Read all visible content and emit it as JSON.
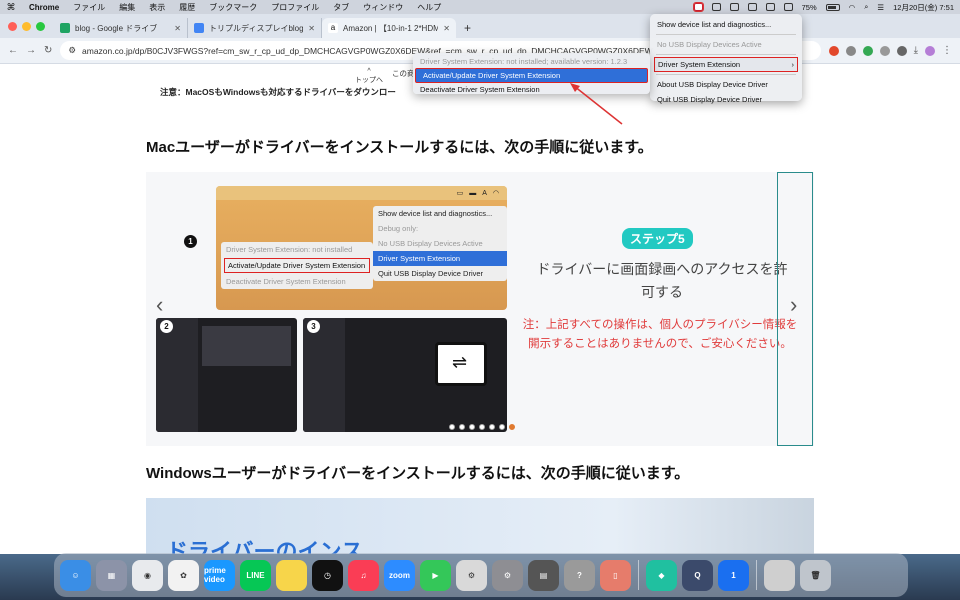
{
  "menubar": {
    "app": "Chrome",
    "items": [
      "ファイル",
      "編集",
      "表示",
      "履歴",
      "ブックマーク",
      "プロファイル",
      "タブ",
      "ウィンドウ",
      "ヘルプ"
    ],
    "battery": "75%",
    "datetime": "12月20日(金)  7:51"
  },
  "tabs": [
    {
      "title": "blog - Google ドライブ",
      "color": "#1fa463"
    },
    {
      "title": "トリプルディスプレイblog 最佳",
      "color": "#4285f4"
    },
    {
      "title": "Amazon | 【10-in-1 2*HDMI A",
      "color": "#222222"
    }
  ],
  "omnibox": {
    "url": "amazon.co.jp/dp/B0CJV3FWGS?ref=cm_sw_r_cp_ud_dp_DMCHCAGVGP0WGZ0X6DEW&ref_=cm_sw_r_cp_ud_dp_DMCHCAGVGP0WGZ0X6DEW"
  },
  "page": {
    "top_link": "トップへ",
    "cut_text": "この商",
    "note": "注意：MacOSもWindowsも対応するドライバーをダウンロー",
    "heading_mac": "Macユーザーがドライバーをインストールするには、次の手順に従います。",
    "heading_win": "Windowsユーザーがドライバーをインストールするには、次の手順に従います。",
    "bottom_big": "ドライバーのインス"
  },
  "slide": {
    "mock_menu": [
      "Show device list and diagnostics...",
      "Debug only:",
      "No USB Display Devices Active",
      "Driver System Extension",
      "Quit USB Display Device Driver"
    ],
    "mock_sub": [
      "Driver System Extension: not installed",
      "Activate/Update Driver System Extension",
      "Deactivate Driver System Extension"
    ],
    "numbers": [
      "1",
      "2",
      "3"
    ],
    "step_pill": "ステップ5",
    "step_title": "ドライバーに画面録画へのアクセスを許可する",
    "step_note": "注：上記すべての操作は、個人のプライバシー情報を開示することはありませんので、ご安心ください。",
    "prev": "‹",
    "next": "›",
    "active_dot": 6
  },
  "sysmenu": {
    "items": [
      "Show device list and diagnostics...",
      "No USB Display Devices Active",
      "Driver System Extension",
      "About USB Display Device Driver",
      "Quit USB Display Device Driver"
    ]
  },
  "submenu": {
    "items": [
      "Driver System Extension: not installed; available version: 1.2.3",
      "Activate/Update Driver System Extension",
      "Deactivate Driver System Extension"
    ]
  },
  "dock": {
    "apps": [
      {
        "name": "finder",
        "label": "☺",
        "color": "#3a8ee6"
      },
      {
        "name": "launchpad",
        "label": "▦",
        "color": "#8c93a8"
      },
      {
        "name": "chrome",
        "label": "◉",
        "color": "#e8eaed"
      },
      {
        "name": "photos",
        "label": "✿",
        "color": "#f2f2f2"
      },
      {
        "name": "prime-video",
        "label": "prime video",
        "color": "#1a98ff"
      },
      {
        "name": "line",
        "label": "LINE",
        "color": "#06c755"
      },
      {
        "name": "notes",
        "label": "",
        "color": "#f7d54a"
      },
      {
        "name": "clock",
        "label": "◷",
        "color": "#111111"
      },
      {
        "name": "music",
        "label": "♫",
        "color": "#fa3d55"
      },
      {
        "name": "zoom",
        "label": "zoom",
        "color": "#2d8cff"
      },
      {
        "name": "facetime",
        "label": "▶",
        "color": "#34c759"
      },
      {
        "name": "mouse-app",
        "label": "⚙",
        "color": "#d9d9d9"
      },
      {
        "name": "system-settings",
        "label": "⚙",
        "color": "#8e8e93"
      },
      {
        "name": "calculator",
        "label": "▤",
        "color": "#555555"
      },
      {
        "name": "help",
        "label": "?",
        "color": "#9a9a9a"
      },
      {
        "name": "iphone-mirroring",
        "label": "▯",
        "color": "#e67c6b"
      },
      {
        "name": "filmora",
        "label": "◆",
        "color": "#20c0a0"
      },
      {
        "name": "quicktime",
        "label": "Q",
        "color": "#3b4a6b"
      },
      {
        "name": "1password",
        "label": "1",
        "color": "#1a6ff0"
      },
      {
        "name": "downloads-stack",
        "label": "",
        "color": "#cfcfcf"
      },
      {
        "name": "trash",
        "label": "🗑",
        "color": "#bfc5cc"
      }
    ]
  }
}
